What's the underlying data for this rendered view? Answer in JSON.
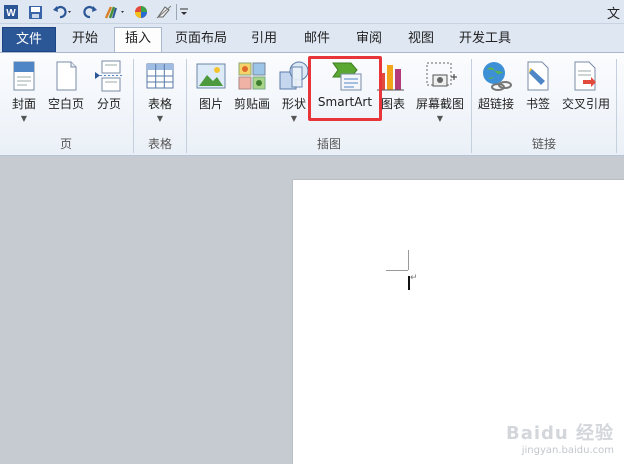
{
  "window": {
    "title": "文"
  },
  "quick_access": {
    "icons": [
      "word-app-icon",
      "save-icon",
      "undo-icon",
      "redo-icon",
      "format-painter-icon",
      "color-wheel-icon",
      "clear-format-icon",
      "customize-toolbar-icon"
    ]
  },
  "tabs": [
    {
      "label": "文件"
    },
    {
      "label": "开始"
    },
    {
      "label": "插入"
    },
    {
      "label": "页面布局"
    },
    {
      "label": "引用"
    },
    {
      "label": "邮件"
    },
    {
      "label": "审阅"
    },
    {
      "label": "视图"
    },
    {
      "label": "开发工具"
    }
  ],
  "active_tab": "插入",
  "ribbon": {
    "groups": [
      {
        "label": "页",
        "buttons": [
          "封面",
          "空白页",
          "分页"
        ]
      },
      {
        "label": "表格",
        "buttons": [
          "表格"
        ]
      },
      {
        "label": "插图",
        "buttons": [
          "图片",
          "剪贴画",
          "形状",
          "SmartArt",
          "图表",
          "屏幕截图"
        ]
      },
      {
        "label": "链接",
        "buttons": [
          "超链接",
          "书签",
          "交叉引用"
        ]
      }
    ]
  },
  "highlighted_button": "SmartArt",
  "watermark": {
    "line1": "Baidu 经验",
    "line2": "jingyan.baidu.com"
  },
  "colors": {
    "file_tab": "#2b5797",
    "highlight": "#e8353a",
    "ribbon_bg": "#eaf0f7",
    "doc_bg": "#c6cad1"
  }
}
